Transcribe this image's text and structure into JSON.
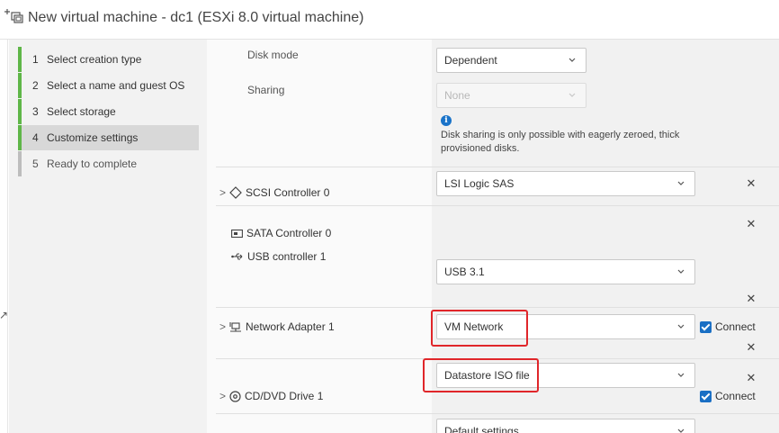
{
  "window": {
    "title": "New virtual machine - dc1 (ESXi 8.0 virtual machine)",
    "icon": "new-vm-icon"
  },
  "wizard": {
    "steps": [
      {
        "num": "1",
        "label": "Select creation type",
        "state": "done"
      },
      {
        "num": "2",
        "label": "Select a name and guest OS",
        "state": "done"
      },
      {
        "num": "3",
        "label": "Select storage",
        "state": "done"
      },
      {
        "num": "4",
        "label": "Customize settings",
        "state": "active"
      },
      {
        "num": "5",
        "label": "Ready to complete",
        "state": "pending"
      }
    ]
  },
  "settings": {
    "disk_mode": {
      "label": "Disk mode",
      "value": "Dependent"
    },
    "sharing": {
      "label": "Sharing",
      "value": "None",
      "info": "Disk sharing is only possible with eagerly zeroed, thick provisioned disks."
    },
    "scsi": {
      "label": "SCSI Controller 0",
      "value": "LSI Logic SAS",
      "icon": "scsi-controller-icon"
    },
    "sata": {
      "label": "SATA Controller 0",
      "icon": "sata-controller-icon"
    },
    "usb": {
      "label": "USB controller 1",
      "value": "USB 3.1",
      "icon": "usb-icon"
    },
    "network": {
      "label": "Network Adapter 1",
      "value": "VM Network",
      "connect_label": "Connect",
      "connected": true,
      "icon": "network-adapter-icon"
    },
    "cdrom": {
      "label": "CD/DVD Drive 1",
      "value": "Datastore ISO file",
      "connect_label": "Connect",
      "connected": true,
      "icon": "cd-dvd-icon"
    },
    "next": {
      "value": "Default settings"
    }
  },
  "colors": {
    "accent_green": "#5fb648",
    "highlight_red": "#e0262a",
    "checkbox_blue": "#1a6fc4",
    "info_blue": "#1a73c9"
  }
}
